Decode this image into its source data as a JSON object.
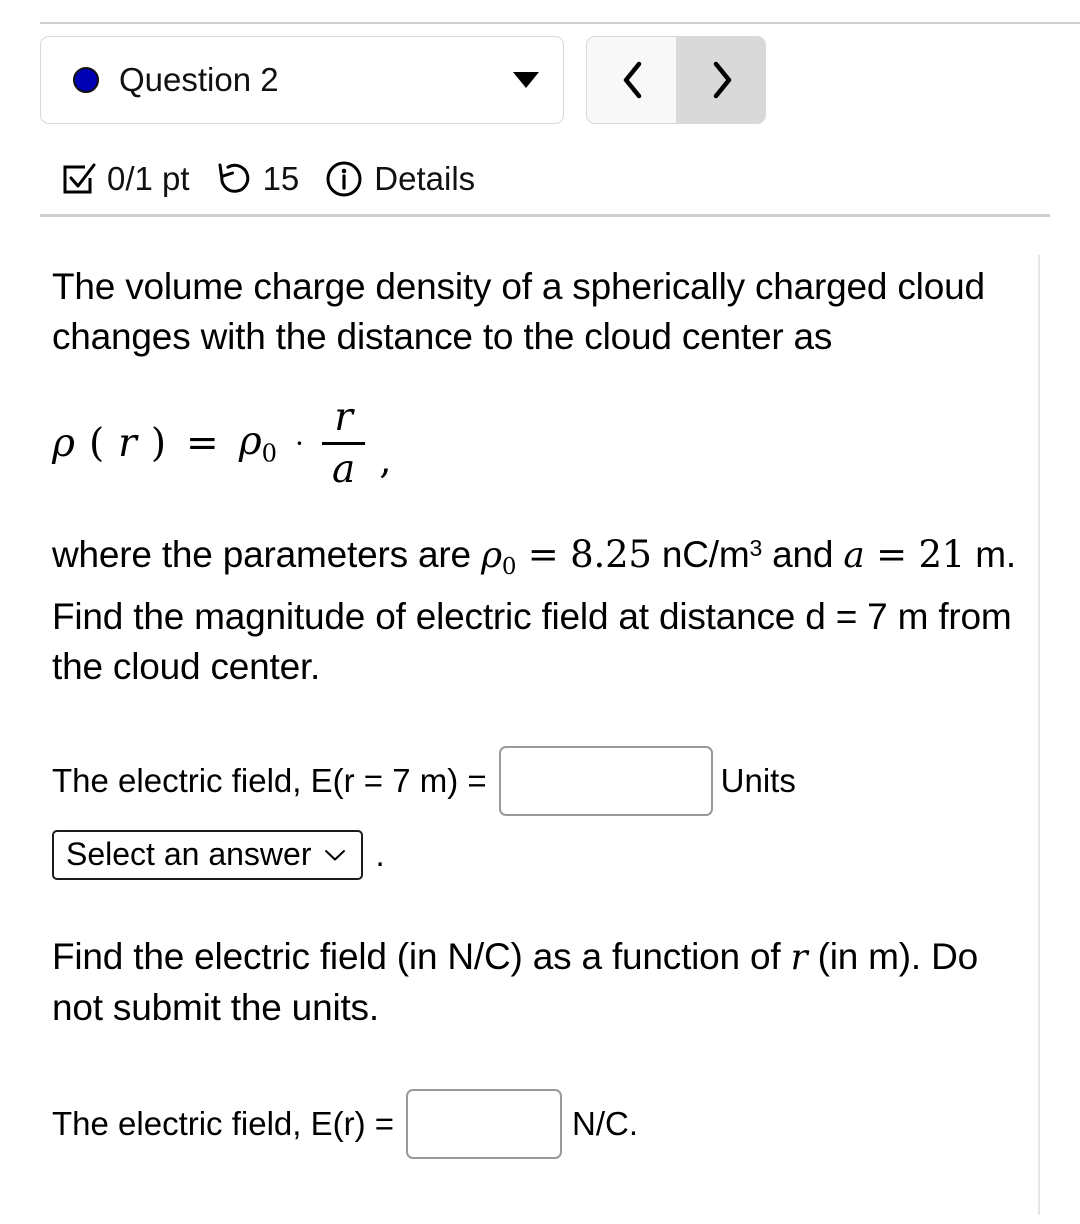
{
  "header": {
    "question_label": "Question 2",
    "status_dot_color": "#0000b4",
    "dropdown_icon": "caret-down-icon",
    "prev_label": "‹",
    "next_label": "›"
  },
  "meta": {
    "score": "0/1 pt",
    "attempts": "15",
    "details_label": "Details",
    "checkbox_icon": "checkbox-checked-icon",
    "retry_icon": "rotate-left-icon",
    "info_icon": "info-circle-icon"
  },
  "question": {
    "intro": "The volume charge density of a spherically charged cloud changes with the distance to the cloud center as",
    "equation": {
      "lhs_rho": "ρ",
      "lhs_open": "(",
      "lhs_var": "r",
      "lhs_close": ")",
      "equals": "=",
      "rho0_sym": "ρ",
      "rho0_sub": "0",
      "dot": "·",
      "numerator": "r",
      "denominator": "a",
      "comma": ","
    },
    "params_prefix": "where the parameters are ",
    "rho_sym": "ρ",
    "rho_sub": "0",
    "rho_equals": " = ",
    "rho_value": "8.25",
    "rho_unit": " nC/m",
    "rho_unit_exp": "3",
    "params_and": " and ",
    "a_sym": "a",
    "a_equals": " = ",
    "a_value": "21",
    "a_unit": " m.",
    "params_tail": " Find the magnitude of electric field at distance d = 7 m from the cloud center."
  },
  "answer1": {
    "prompt": "The electric field, E(r = 7 m) =",
    "input_value": "",
    "input_placeholder": "",
    "units_label": "Units",
    "select_value": "Select an answer",
    "select_icon": "chevron-down-icon",
    "period": "."
  },
  "findfield": {
    "prefix": "Find the electric field (in N/C) as a function of ",
    "var": "r",
    "suffix": " (in m). Do not submit the units."
  },
  "answer2": {
    "prompt": "The electric field, E(r) =",
    "input_value": "",
    "input_placeholder": "",
    "unit_label": "N/C."
  }
}
